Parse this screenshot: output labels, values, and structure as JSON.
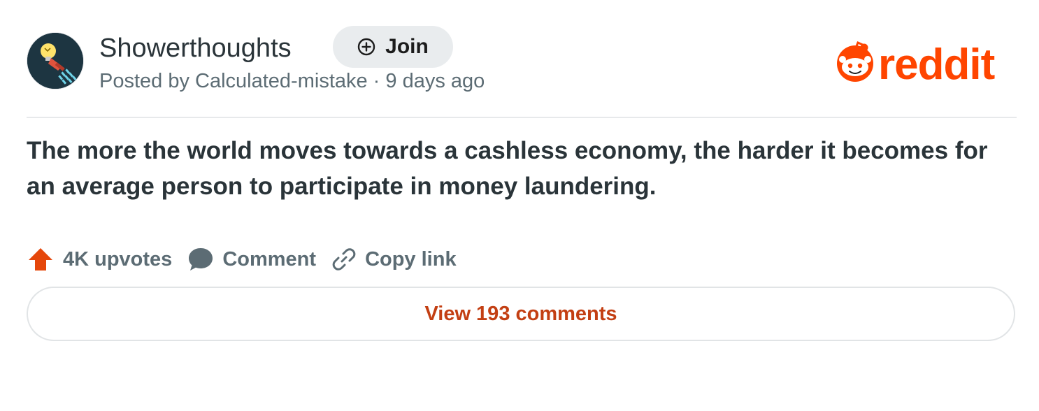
{
  "post": {
    "subreddit": "Showerthoughts",
    "join_label": "Join",
    "posted_by": "Posted by Calculated-mistake · 9 days ago",
    "title": "The more the world moves towards a cashless economy, the harder it becomes for an average person to participate in money laundering.",
    "logo_text": "reddit"
  },
  "actions": {
    "upvotes": "4K upvotes",
    "comment": "Comment",
    "copy_link": "Copy link"
  },
  "footer": {
    "view_comments": "View 193 comments"
  },
  "icons": {
    "avatar": "lightbulb-shower-icon",
    "join": "plus-circle-icon",
    "logo": "reddit-snoo-icon",
    "upvote": "upvote-arrow-icon",
    "comment": "comment-bubble-icon",
    "copy_link": "link-icon"
  },
  "colors": {
    "reddit_orange": "#ff4500",
    "upvote_orange": "#e5470b",
    "view_comments_text": "#c33f13",
    "muted_text": "#5c6c74",
    "join_bg": "#e9ecee",
    "avatar_bg": "#1d3541"
  }
}
